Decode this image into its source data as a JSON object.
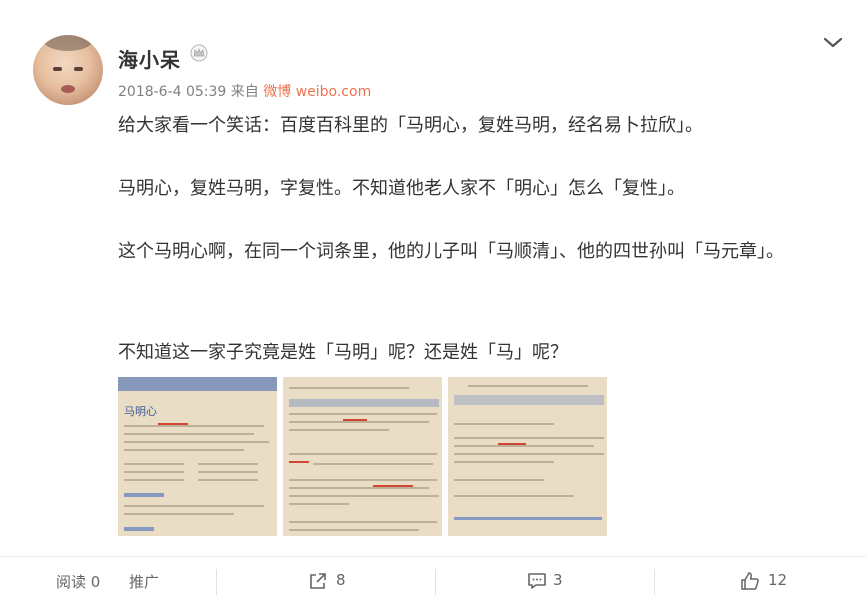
{
  "post": {
    "username": "海小呆",
    "timestamp": "2018-6-4 05:39",
    "from_label": "来自",
    "source_app": "微博 weibo.com",
    "paragraphs": [
      "给大家看一个笑话：百度百科里的「马明心，复姓马明，经名易卜拉欣」。",
      "马明心，复姓马明，字复性。不知道他老人家不「明心」怎么「复性」。",
      "这个马明心啊，在同一个词条里，他的儿子叫「马顺清」、他的四世孙叫「马元章」。",
      "不知道这一家子究竟是姓「马明」呢？还是姓「马」呢？"
    ],
    "images": [
      {
        "label": "马明心"
      },
      {
        "label": ""
      },
      {
        "label": ""
      }
    ]
  },
  "footer": {
    "reads_label": "阅读",
    "reads_count": "0",
    "promote_label": "推广",
    "repost_count": "8",
    "comment_count": "3",
    "like_count": "12"
  },
  "icons": {
    "crown": "crown-icon",
    "more": "chevron-down-icon",
    "repost": "repost-icon",
    "comment": "comment-icon",
    "like": "thumbs-up-icon"
  },
  "colors": {
    "source": "#eb7350",
    "meta": "#808080",
    "text": "#333333"
  }
}
